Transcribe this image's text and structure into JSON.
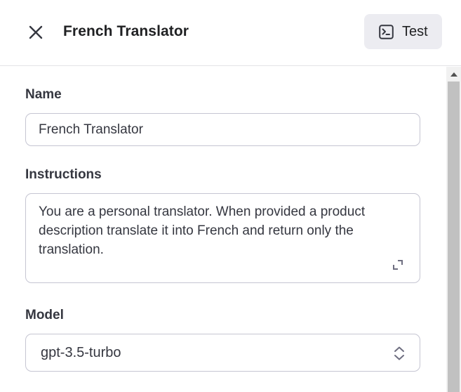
{
  "header": {
    "title": "French Translator",
    "test_label": "Test"
  },
  "form": {
    "name_label": "Name",
    "name_value": "French Translator",
    "instructions_label": "Instructions",
    "instructions_value": "You are a personal translator. When provided a product description translate it into French and return only the translation.",
    "model_label": "Model",
    "model_value": "gpt-3.5-turbo"
  },
  "icons": {
    "close": "close-icon",
    "test": "terminal-icon",
    "expand": "expand-icon",
    "select": "chevron-up-down-icon",
    "scroll_up": "scroll-up-arrow-icon"
  }
}
